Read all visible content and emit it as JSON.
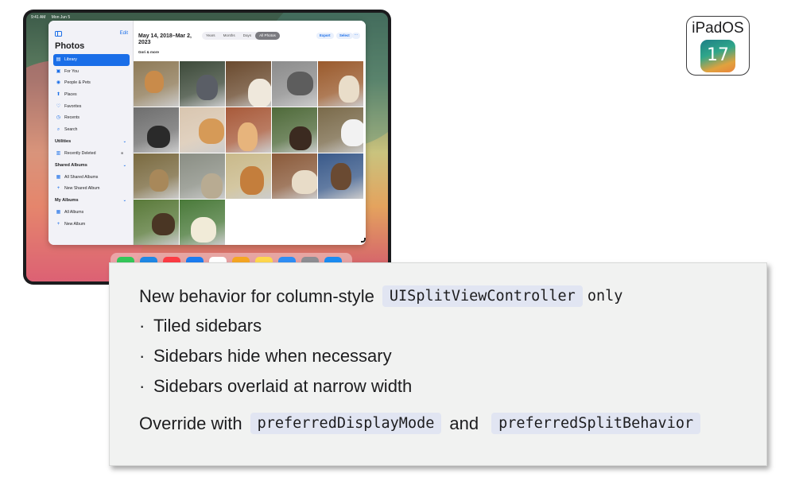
{
  "status_bar": {
    "time": "9:41 AM",
    "date": "Mon Jun 5"
  },
  "photos_app": {
    "edit_label": "Edit",
    "sidebar_title": "Photos",
    "sidebar_items": [
      {
        "label": "Library",
        "icon": "library-icon",
        "glyph": "▤"
      },
      {
        "label": "For You",
        "icon": "for-you-icon",
        "glyph": "▣"
      },
      {
        "label": "People & Pets",
        "icon": "people-icon",
        "glyph": "◉"
      },
      {
        "label": "Places",
        "icon": "places-icon",
        "glyph": "⬆"
      },
      {
        "label": "Favorites",
        "icon": "heart-icon",
        "glyph": "♡"
      },
      {
        "label": "Recents",
        "icon": "clock-icon",
        "glyph": "◷"
      },
      {
        "label": "Search",
        "icon": "search-icon",
        "glyph": "⌕"
      }
    ],
    "sections": {
      "utilities": {
        "title": "Utilities",
        "items": [
          {
            "label": "Recently Deleted",
            "icon": "trash-icon",
            "glyph": "🗑"
          }
        ]
      },
      "shared_albums": {
        "title": "Shared Albums",
        "items": [
          {
            "label": "All Shared Albums",
            "icon": "shared-albums-icon",
            "glyph": "▦"
          },
          {
            "label": "New Shared Album",
            "icon": "plus-icon",
            "glyph": "+"
          }
        ]
      },
      "my_albums": {
        "title": "My Albums",
        "items": [
          {
            "label": "All Albums",
            "icon": "albums-icon",
            "glyph": "▦"
          },
          {
            "label": "New Album",
            "icon": "plus-icon",
            "glyph": "+"
          }
        ]
      }
    },
    "header": {
      "date_range": "May 14, 2018–Mar 2, 2023",
      "subtitle": "Gori & more",
      "segments": [
        "Years",
        "Months",
        "Days",
        "All Photos"
      ],
      "selected_segment": "All Photos",
      "export_label": "Export",
      "select_label": "Select",
      "more_label": "···"
    },
    "photo_count": 17
  },
  "dock": {
    "apps": [
      "messages",
      "safari",
      "music",
      "mail",
      "calendar",
      "photos",
      "notes",
      "files",
      "settings",
      "app-store"
    ],
    "calendar_label": "MON"
  },
  "badge": {
    "os_name": "iPadOS",
    "version": "17"
  },
  "callout": {
    "intro_text": "New behavior for column-style",
    "intro_code": "UISplitViewController",
    "intro_suffix": "only",
    "bullets": [
      "Tiled sidebars",
      "Sidebars hide when necessary",
      "Sidebars overlaid at narrow width"
    ],
    "override_text": "Override with",
    "override_code_1": "preferredDisplayMode",
    "override_and": "and",
    "override_code_2": "preferredSplitBehavior"
  },
  "colors": {
    "accent": "#1a6ee8",
    "panel_background": "#f1f2f1",
    "code_background": "#e1e5f2"
  }
}
